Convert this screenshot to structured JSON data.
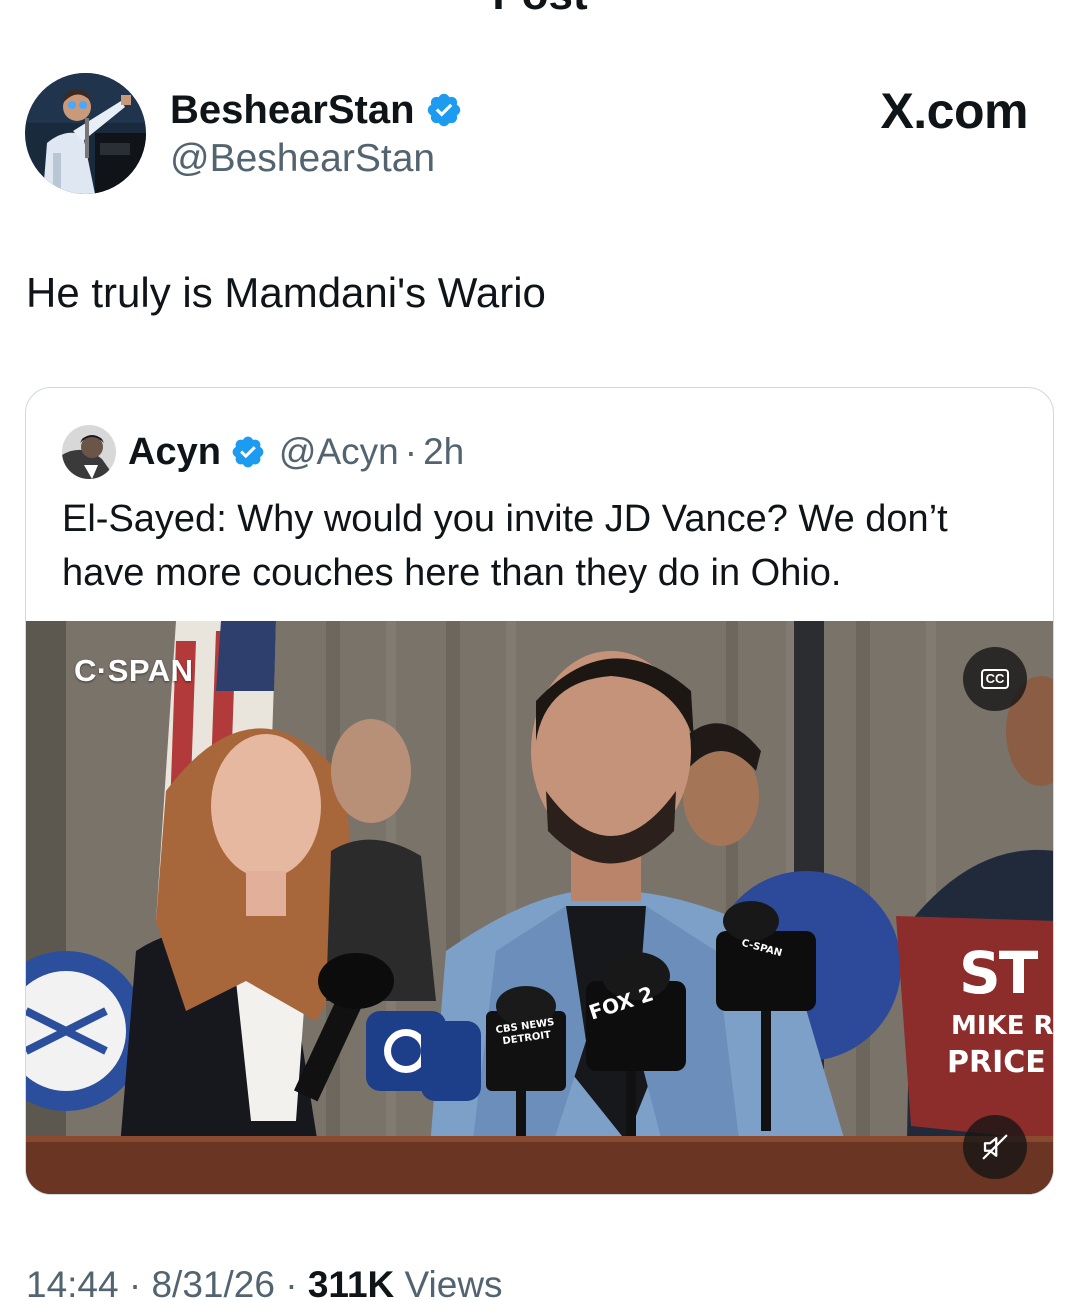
{
  "header": {
    "title": "Post",
    "back_icon": "chevron-left-icon"
  },
  "watermark": "X.com",
  "author": {
    "name": "BeshearStan",
    "handle": "@BeshearStan",
    "verified": true,
    "verified_color": "#1d9bf0"
  },
  "post": {
    "text": "He truly is Mamdani's Wario"
  },
  "quote": {
    "name": "Acyn",
    "handle": "@Acyn",
    "separator": "·",
    "time": "2h",
    "verified": true,
    "text": "El-Sayed: Why would you invite JD Vance? We don’t have more couches here than they do in Ohio.",
    "video": {
      "network_logo": "C·SPAN",
      "cc_label": "CC",
      "mute_icon": "speaker-muted-icon",
      "mic_labels": {
        "fox": "FOX 2",
        "cbs": "CBS NEWS DETROIT",
        "cspan": "C-SPAN"
      },
      "sign": {
        "line1": "ST",
        "line2": "MIKE R",
        "line3": "PRICE"
      }
    }
  },
  "meta": {
    "time": "14:44",
    "sep1": " · ",
    "date": "8/31/26",
    "sep2": " · ",
    "views_count": "311K",
    "views_label": " Views"
  },
  "colors": {
    "text_primary": "#0f1419",
    "text_secondary": "#536471",
    "border": "#cfd9de",
    "verified": "#1d9bf0"
  }
}
